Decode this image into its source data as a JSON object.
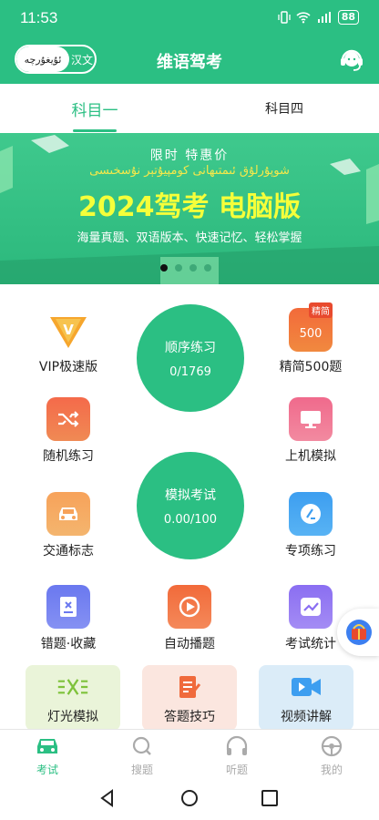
{
  "status_bar": {
    "time": "11:53",
    "battery": "88"
  },
  "header": {
    "lang_uy": "ئۇيغۇرچە",
    "lang_cn": "汉文",
    "title": "维语驾考"
  },
  "tabs": [
    {
      "label": "科目一",
      "active": true
    },
    {
      "label": "科目四",
      "active": false
    }
  ],
  "banner": {
    "promo": "限时  特惠价",
    "uy": "شوپۇرلۇق ئىمتىھانى كومپيۇتېر نۇسخىسى",
    "main": "2024驾考  电脑版",
    "sub": "海量真题、双语版本、快速记忆、轻松掌握",
    "dots": 4,
    "active_dot": 0
  },
  "grid": {
    "vip": "VIP极速版",
    "jingjian_badge": "精简",
    "jingjian_num": "500",
    "jingjian": "精简500题",
    "shunxu": {
      "title": "顺序练习",
      "value": "0/1769"
    },
    "suiji": "随机练习",
    "shangji": "上机模拟",
    "moni": {
      "title": "模拟考试",
      "value": "0.00/100"
    },
    "jiaotong": "交通标志",
    "zhuanxiang": "专项练习",
    "cuoti": "错题·收藏",
    "zidong": "自动播题",
    "tongji": "考试统计"
  },
  "cards": {
    "dengguang": "灯光模拟",
    "jiqiao": "答题技巧",
    "shipin": "视频讲解"
  },
  "bottom_nav": [
    {
      "label": "考试",
      "icon": "car-icon",
      "active": true
    },
    {
      "label": "搜题",
      "icon": "search-icon",
      "active": false
    },
    {
      "label": "听题",
      "icon": "headphones-icon",
      "active": false
    },
    {
      "label": "我的",
      "icon": "steering-wheel-icon",
      "active": false
    }
  ],
  "colors": {
    "primary": "#2bbf83",
    "banner_yellow": "#f5ff3a",
    "vip_orange": "#f29b2a",
    "badge_red": "#e84a2e"
  }
}
